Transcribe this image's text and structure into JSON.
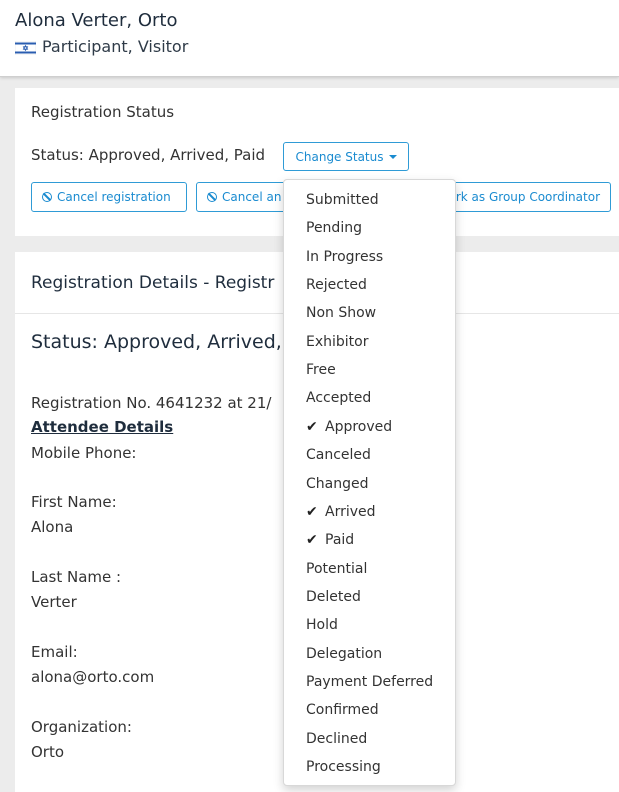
{
  "header": {
    "name": "Alona Verter, Orto",
    "roles": "Participant, Visitor",
    "flag_icon": "israel-flag-icon"
  },
  "registration_status": {
    "title": "Registration Status",
    "status_text": "Status: Approved, Arrived, Paid",
    "change_status_label": "Change Status",
    "cancel_registration_label": "Cancel registration",
    "cancel_and_label": "Cancel an",
    "group_coordinator_label": "rk as Group Coordinator"
  },
  "status_menu": {
    "items": [
      {
        "label": "Submitted",
        "checked": false
      },
      {
        "label": "Pending",
        "checked": false
      },
      {
        "label": "In Progress",
        "checked": false
      },
      {
        "label": "Rejected",
        "checked": false
      },
      {
        "label": "Non Show",
        "checked": false
      },
      {
        "label": "Exhibitor",
        "checked": false
      },
      {
        "label": "Free",
        "checked": false
      },
      {
        "label": "Accepted",
        "checked": false
      },
      {
        "label": "Approved",
        "checked": true
      },
      {
        "label": "Canceled",
        "checked": false
      },
      {
        "label": "Changed",
        "checked": false
      },
      {
        "label": "Arrived",
        "checked": true
      },
      {
        "label": "Paid",
        "checked": true
      },
      {
        "label": "Potential",
        "checked": false
      },
      {
        "label": "Deleted",
        "checked": false
      },
      {
        "label": "Hold",
        "checked": false
      },
      {
        "label": "Delegation",
        "checked": false
      },
      {
        "label": "Payment Deferred",
        "checked": false
      },
      {
        "label": "Confirmed",
        "checked": false
      },
      {
        "label": "Declined",
        "checked": false
      },
      {
        "label": "Processing",
        "checked": false
      }
    ]
  },
  "details": {
    "title": "Registration Details - Registr",
    "status_text": "Status: Approved, Arrived, P",
    "registration_no": "Registration No. 4641232 at 21/",
    "attendee_heading": "Attendee Details",
    "fields": [
      {
        "label": "Mobile Phone:",
        "value": ""
      },
      {
        "label": "First Name:",
        "value": "Alona"
      },
      {
        "label": "Last Name :",
        "value": "Verter"
      },
      {
        "label": "Email:",
        "value": "alona@orto.com"
      },
      {
        "label": "Organization:",
        "value": "Orto"
      }
    ]
  },
  "colors": {
    "accent": "#1a8bd0",
    "text_dark": "#1f2d3d",
    "background": "#ececec"
  }
}
